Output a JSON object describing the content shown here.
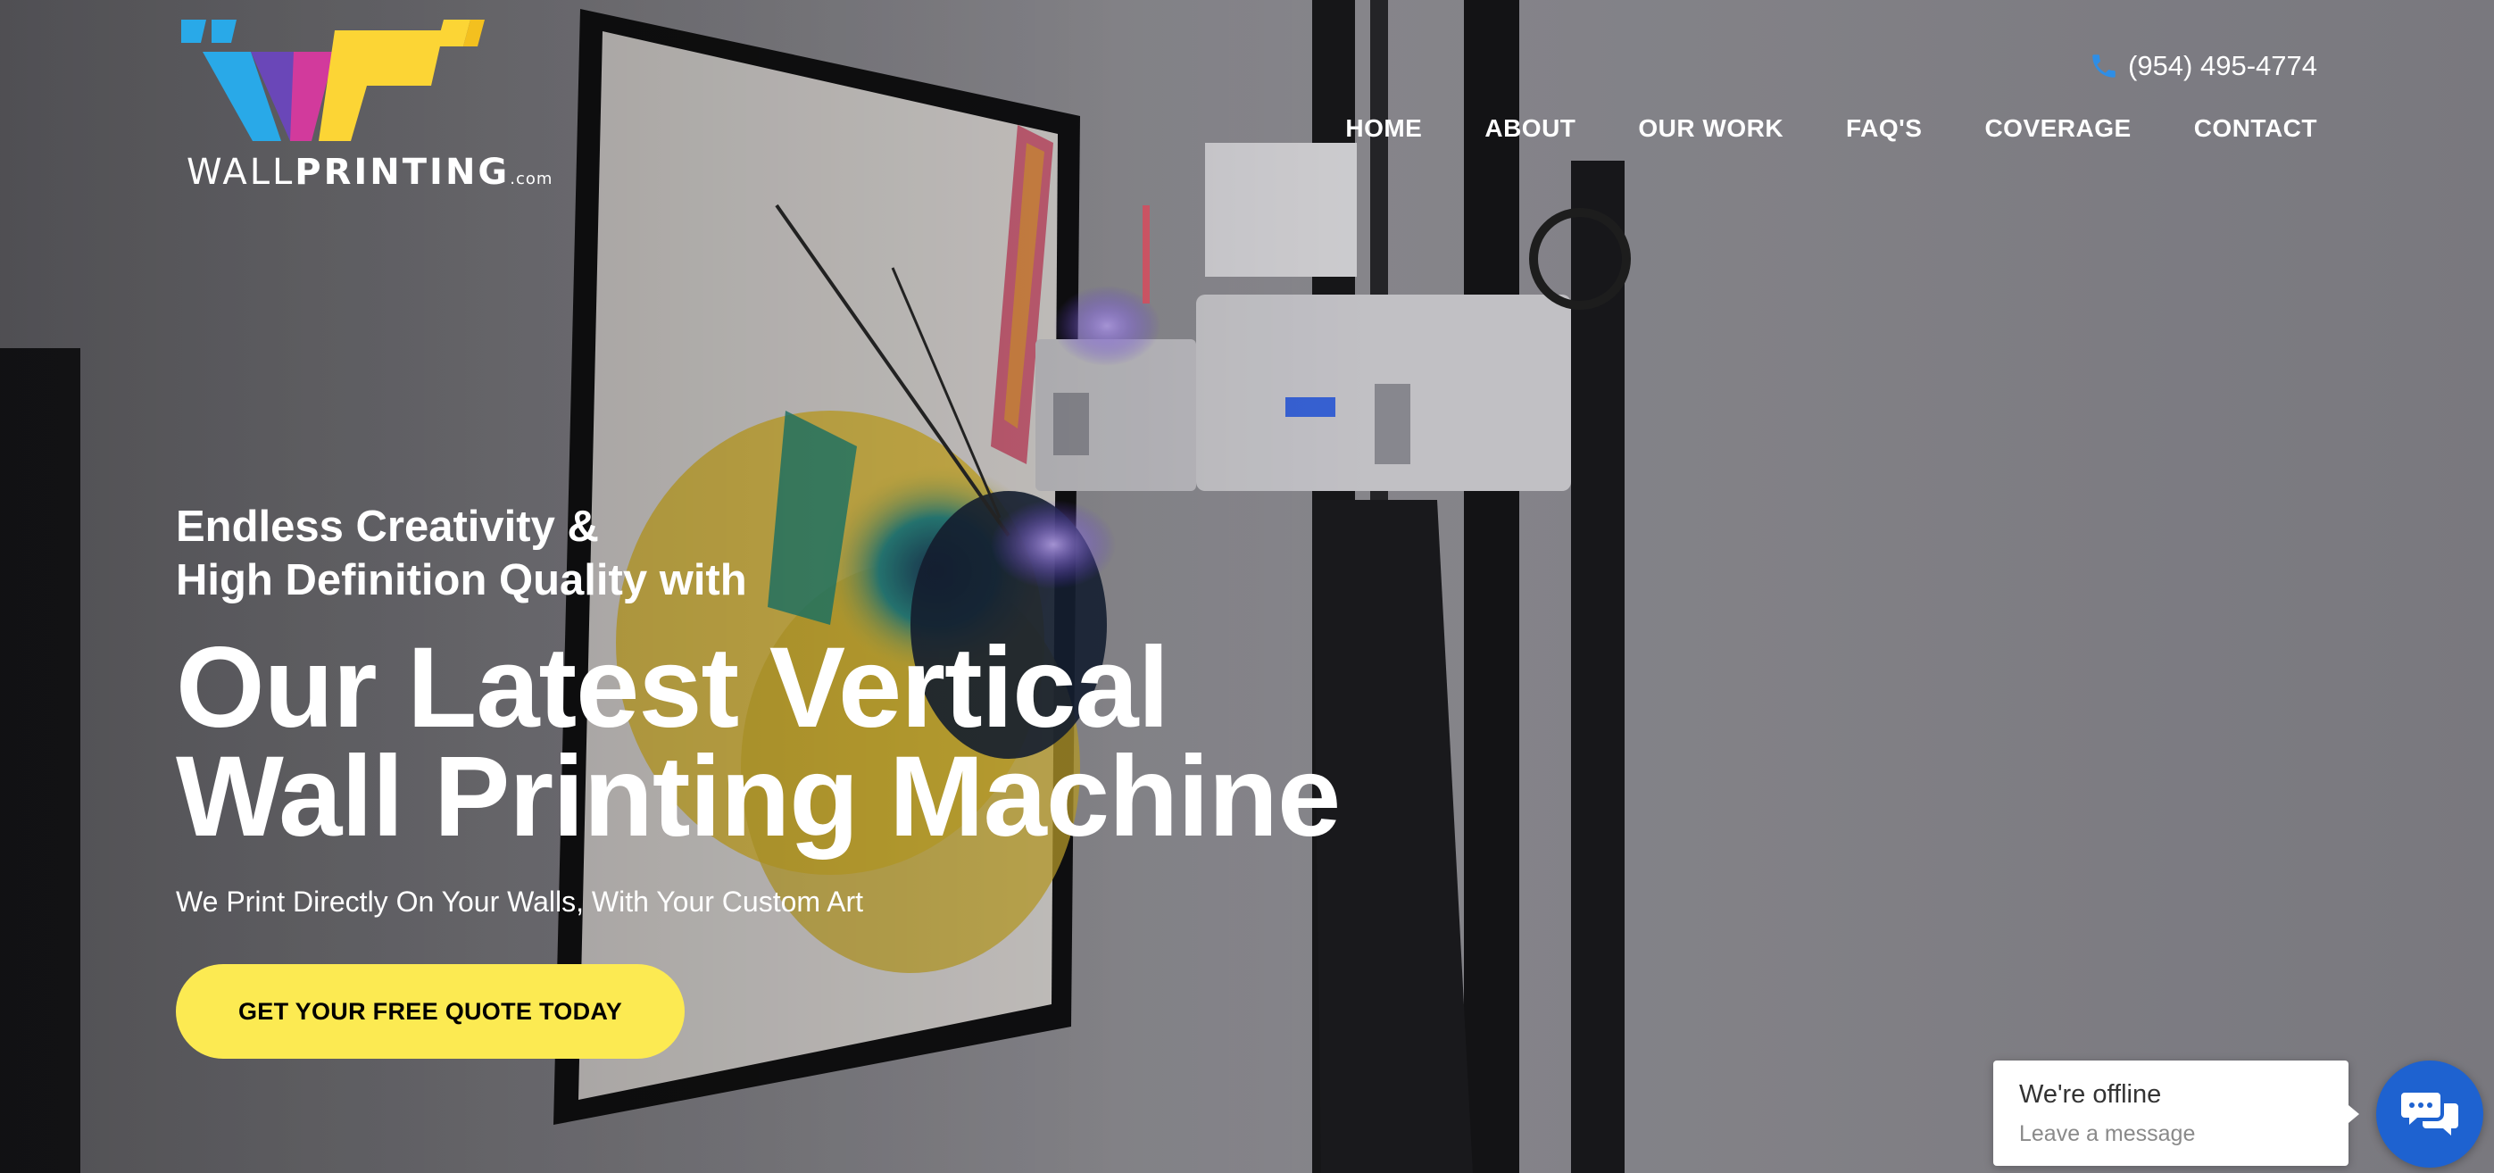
{
  "brand": {
    "logo_word_light": "WALL",
    "logo_word_bold": "PRINTING",
    "logo_tld": ".com",
    "colors": {
      "cyan": "#29a9e8",
      "magenta": "#d23a9c",
      "yellow": "#fcd535",
      "purple": "#7b3fa0"
    }
  },
  "header": {
    "phone": "(954) 495-4774",
    "phone_icon": "phone-icon",
    "nav": [
      {
        "label": "HOME"
      },
      {
        "label": "ABOUT"
      },
      {
        "label": "OUR WORK"
      },
      {
        "label": "FAQ'S"
      },
      {
        "label": "COVERAGE"
      },
      {
        "label": "CONTACT"
      }
    ]
  },
  "hero": {
    "lead_line1": "Endless Creativity &",
    "lead_line2": "High Definition Quality with",
    "title_line1": "Our Latest Vertical",
    "title_line2": "Wall Printing Machine",
    "subtitle": "We Print Directly On Your Walls, With Your Custom Art",
    "cta_label": "GET YOUR FREE QUOTE TODAY",
    "cta_color": "#fcea52"
  },
  "chat": {
    "status": "We're offline",
    "hint": "Leave a message",
    "icon": "chat-bubbles-icon",
    "button_color": "#1e62d0"
  }
}
